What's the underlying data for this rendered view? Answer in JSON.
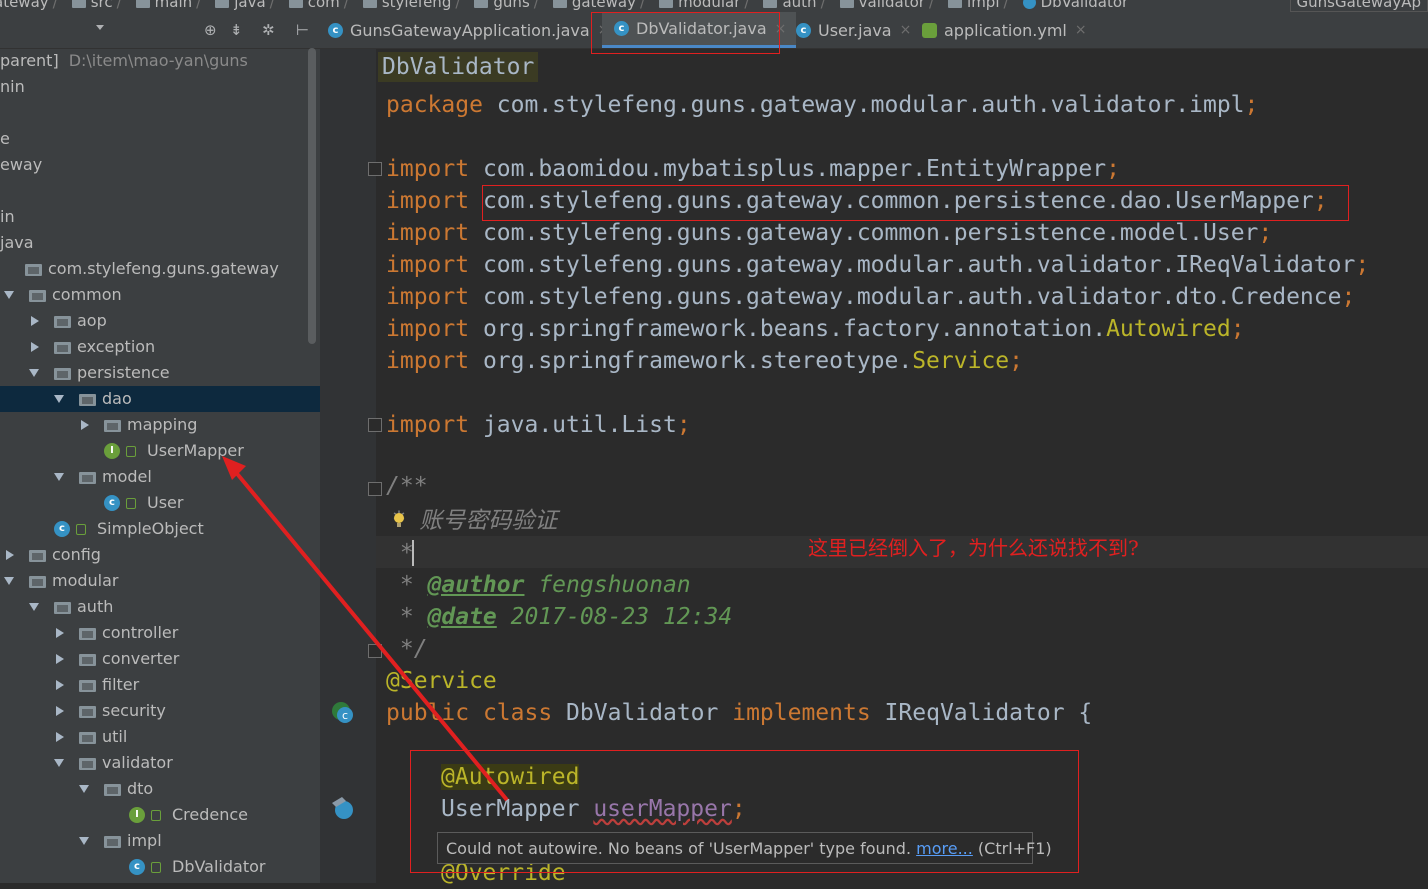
{
  "breadcrumb": {
    "items": [
      "ateway",
      "src",
      "main",
      "java",
      "com",
      "stylefeng",
      "guns",
      "gateway",
      "modular",
      "auth",
      "validator",
      "impl",
      "DbValidator"
    ],
    "run_config": "GunsGatewayAp"
  },
  "project": {
    "rows": [
      {
        "label": "parent]",
        "path": "D:\\item\\mao-yan\\guns"
      },
      {
        "label": "nin"
      },
      {
        "label": ""
      },
      {
        "label": "e"
      },
      {
        "label": "eway"
      },
      {
        "label": ""
      },
      {
        "label": "in"
      },
      {
        "label": "java"
      },
      {
        "label": "com.stylefeng.guns.gateway"
      },
      {
        "label": "common"
      },
      {
        "label": "aop"
      },
      {
        "label": "exception"
      },
      {
        "label": "persistence"
      },
      {
        "label": "dao"
      },
      {
        "label": "mapping"
      },
      {
        "label": "UserMapper"
      },
      {
        "label": "model"
      },
      {
        "label": "User"
      },
      {
        "label": "SimpleObject"
      },
      {
        "label": "config"
      },
      {
        "label": "modular"
      },
      {
        "label": "auth"
      },
      {
        "label": "controller"
      },
      {
        "label": "converter"
      },
      {
        "label": "filter"
      },
      {
        "label": "security"
      },
      {
        "label": "util"
      },
      {
        "label": "validator"
      },
      {
        "label": "dto"
      },
      {
        "label": "Credence"
      },
      {
        "label": "impl"
      },
      {
        "label": "DbValidator"
      }
    ]
  },
  "tabs": [
    {
      "label": "GunsGatewayApplication.java",
      "icon": "class-icon"
    },
    {
      "label": "DbValidator.java",
      "icon": "class-icon"
    },
    {
      "label": "User.java",
      "icon": "class-icon"
    },
    {
      "label": "application.yml",
      "icon": "yml-icon"
    }
  ],
  "editor": {
    "class_header": "DbValidator",
    "code": {
      "package_kw": "package",
      "package_name": " com.stylefeng.guns.gateway.modular.auth.validator.impl",
      "import_kw": "import",
      "imports": [
        {
          "name": " com.baomidou.mybatisplus.mapper.EntityWrapper",
          "hl": ""
        },
        {
          "name": " com.stylefeng.guns.gateway.common.persistence.dao.UserMapper",
          "hl": ""
        },
        {
          "name": " com.stylefeng.guns.gateway.common.persistence.model.User",
          "hl": ""
        },
        {
          "name": " com.stylefeng.guns.gateway.modular.auth.validator.IReqValidator",
          "hl": ""
        },
        {
          "name": " com.stylefeng.guns.gateway.modular.auth.validator.dto.Credence",
          "hl": ""
        },
        {
          "name": " org.springframework.beans.factory.annotation.",
          "hl": "Autowired"
        },
        {
          "name": " org.springframework.stereotype.",
          "hl": "Service"
        }
      ],
      "import_list": " java.util.List",
      "semicolon": ";",
      "doc_open": "/**",
      "doc_line1": " *  账号密码验证",
      "doc_line2": " *",
      "doc_author_tag": "@author",
      "doc_author": " fengshuonan",
      "doc_date_tag": "@date",
      "doc_date": " 2017-08-23 12:34",
      "doc_close": " */",
      "annotation_service": "@Service",
      "class_kw1": "public",
      "class_kw2": "class",
      "class_name": " DbValidator ",
      "implements_kw": "implements",
      "interface": " IReqValidator {",
      "annotation_autowired": "@Autowired",
      "field_type": "UserMapper ",
      "field_name": "userMapper",
      "override": "@Override"
    },
    "note": "这里已经倒入了，为什么还说找不到?",
    "tooltip": {
      "text": "Could not autowire. No beans of 'UserMapper' type found. ",
      "link": "more...",
      "shortcut": " (Ctrl+F1)"
    }
  },
  "colors": {
    "annotation_red": "#e02020",
    "selection": "#0d293e",
    "keyword": "#cc7832"
  }
}
